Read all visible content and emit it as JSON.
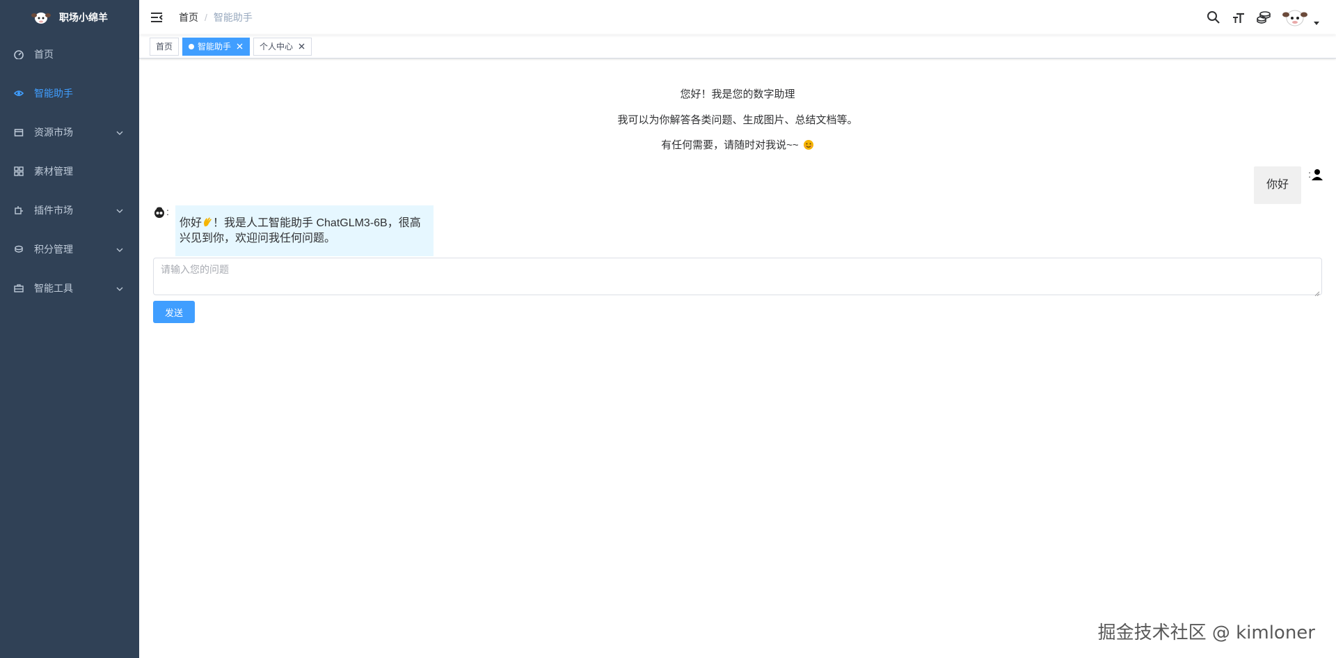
{
  "app": {
    "brand": "职场小绵羊"
  },
  "sidebar": {
    "items": [
      {
        "label": "首页",
        "icon": "dashboard-icon",
        "has_submenu": false,
        "active": false
      },
      {
        "label": "智能助手",
        "icon": "eye-icon",
        "has_submenu": false,
        "active": true
      },
      {
        "label": "资源市场",
        "icon": "shop-icon",
        "has_submenu": true,
        "active": false
      },
      {
        "label": "素材管理",
        "icon": "component-icon",
        "has_submenu": false,
        "active": false
      },
      {
        "label": "插件市场",
        "icon": "plugin-icon",
        "has_submenu": true,
        "active": false
      },
      {
        "label": "积分管理",
        "icon": "coins-icon",
        "has_submenu": true,
        "active": false
      },
      {
        "label": "智能工具",
        "icon": "toolbox-icon",
        "has_submenu": true,
        "active": false
      }
    ]
  },
  "header": {
    "breadcrumb": {
      "home": "首页",
      "separator": "/",
      "current": "智能助手"
    }
  },
  "tags": [
    {
      "label": "首页",
      "active": false,
      "closable": false
    },
    {
      "label": "智能助手",
      "active": true,
      "closable": true
    },
    {
      "label": "个人中心",
      "active": false,
      "closable": true
    }
  ],
  "chat": {
    "welcome_line1": "您好！我是您的数字助理",
    "welcome_line2": "我可以为你解答各类问题、生成图片、总结文档等。",
    "welcome_line3": "有任何需要，请随时对我说~~",
    "user_message": "你好",
    "colon": ":",
    "bot_message_part1": "你好",
    "bot_message_part2": "！我是人工智能助手 ChatGLM3-6B，很高兴见到你，欢迎问我任何问题。",
    "input_placeholder": "请输入您的问题",
    "input_value": "",
    "send_label": "发送"
  },
  "watermark": "掘金技术社区 @ kimloner",
  "colors": {
    "sidebar_bg": "#304156",
    "sidebar_text": "#bfcbd9",
    "accent": "#409eff",
    "bot_bubble": "#e6f7ff",
    "user_bubble": "#f0f0f0"
  }
}
